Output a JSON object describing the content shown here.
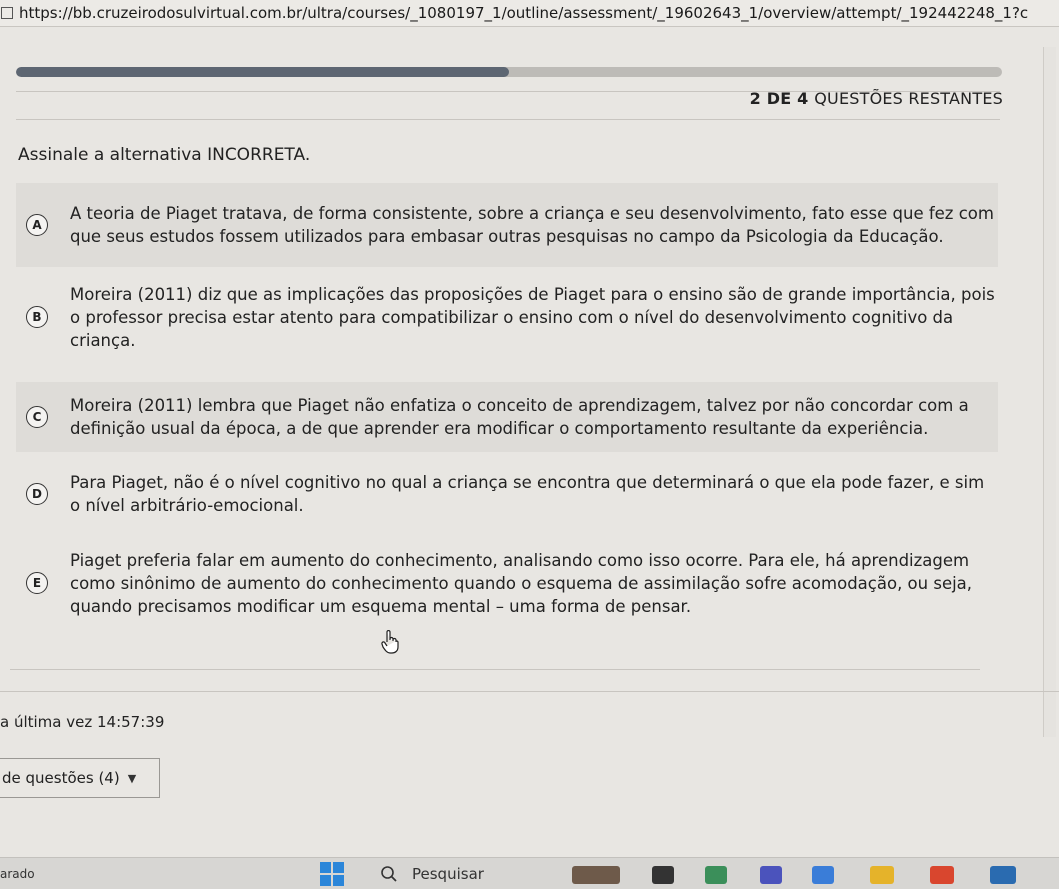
{
  "browser": {
    "url": "https://bb.cruzeirodosulvirtual.com.br/ultra/courses/_1080197_1/outline/assessment/_19602643_1/overview/attempt/_192442248_1?c"
  },
  "assessment": {
    "progress_fraction": 0.5,
    "remaining_strong": "2 DE 4",
    "remaining_rest": "QUESTÕES RESTANTES",
    "prompt": "Assinale a alternativa INCORRETA.",
    "options": [
      {
        "letter": "A",
        "text": "A teoria de Piaget tratava, de forma consistente, sobre a criança e seu desenvolvimento, fato esse que fez com que seus estudos fossem utilizados para embasar outras pesquisas no campo da Psicologia da Educação."
      },
      {
        "letter": "B",
        "text": "Moreira (2011) diz que as implicações das proposições de Piaget para o ensino são de grande importância, pois o professor precisa estar atento para compatibilizar o ensino com o nível do desenvolvimento cognitivo da criança."
      },
      {
        "letter": "C",
        "text": "Moreira (2011) lembra que Piaget não enfatiza o conceito de aprendizagem, talvez por não concordar com a definição usual da época, a de que aprender era modificar o comportamento resultante da experiência."
      },
      {
        "letter": "D",
        "text": "Para Piaget, não é o nível cognitivo no qual a criança se encontra que determinará o que ela pode fazer, e sim o nível arbitrário-emocional."
      },
      {
        "letter": "E",
        "text": "Piaget preferia falar em aumento do conhecimento, analisando como isso ocorre. Para ele, há aprendizagem como sinônimo de aumento do conhecimento quando o esquema de assimilação sofre acomodação, ou seja, quando precisamos modificar um esquema mental – uma forma de pensar."
      }
    ]
  },
  "footer": {
    "last_saved": "a última vez 14:57:39",
    "question_select": "de questões (4)"
  },
  "taskbar": {
    "weather": "arado",
    "search_label": "Pesquisar"
  },
  "icons": {
    "page": "page-icon",
    "cursor": "hand-pointer-icon",
    "caret": "caret-down-icon",
    "windows": "windows-start-icon",
    "search": "search-icon"
  }
}
